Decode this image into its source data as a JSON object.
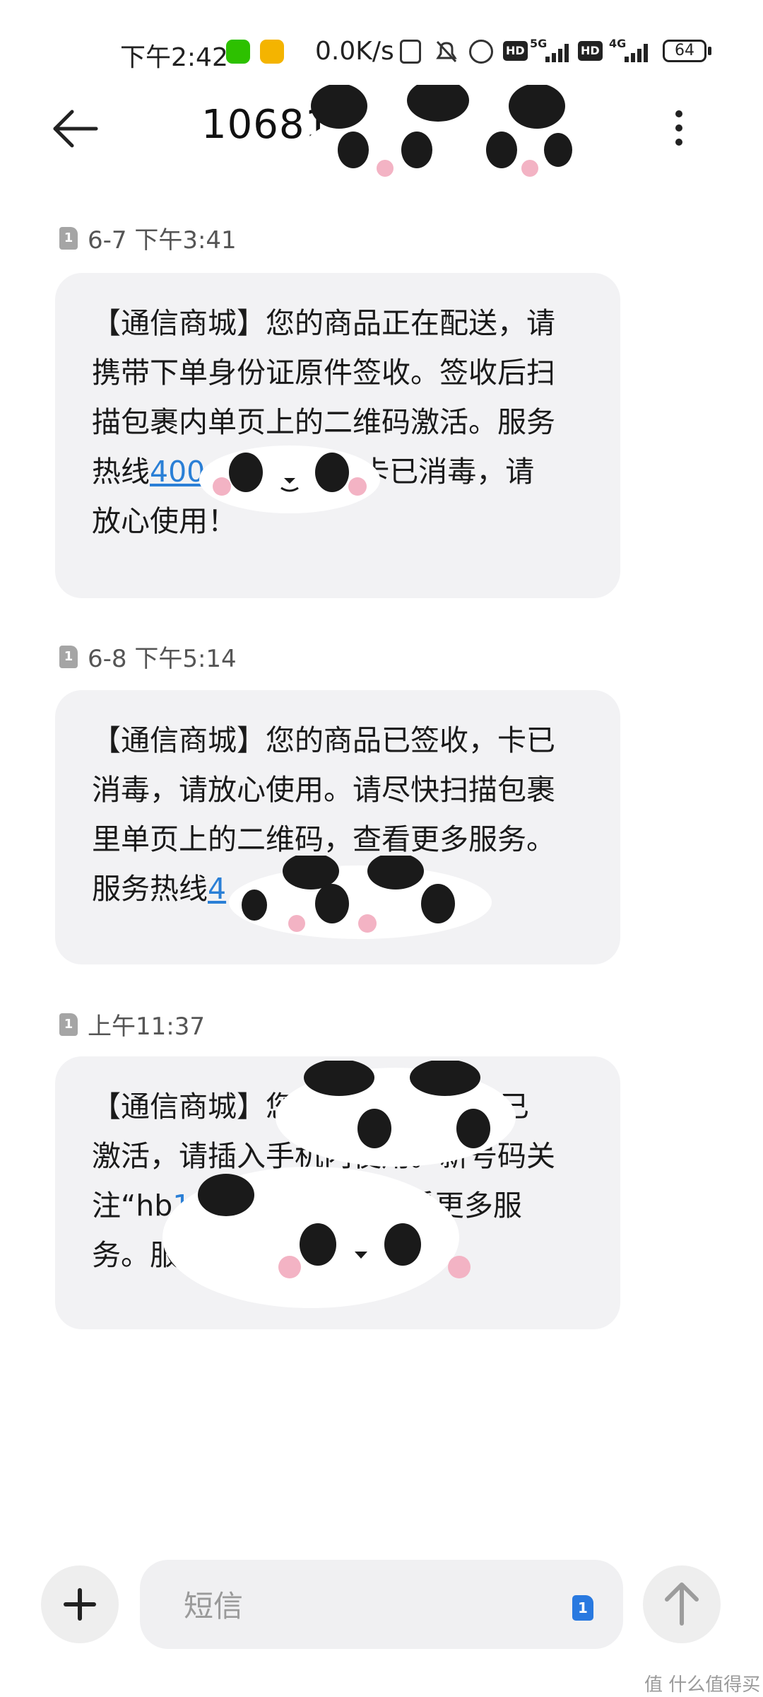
{
  "status_bar": {
    "time": "下午2:42",
    "net_speed": "0.0K/s",
    "sim1_network": "5G",
    "sim2_network": "4G",
    "hd_label": "HD",
    "battery": "64",
    "app_icons": [
      "wechat-icon",
      "weibo-icon"
    ]
  },
  "header": {
    "title": "10681",
    "back_icon": "arrow-left-icon",
    "menu_icon": "more-vertical-icon"
  },
  "messages": [
    {
      "sim": "1",
      "timestamp": "6-7 下午3:41",
      "lines": [
        {
          "text": "【通信商城】您的商品正在配送，请"
        },
        {
          "text": "携带下单身份证原件签收。签收后扫"
        },
        {
          "text": "描包裹内单页上的二维码激活。服务"
        },
        {
          "pre": "热线",
          "link": "400",
          "post": "卡已消毒，请"
        },
        {
          "text": "放心使用！"
        }
      ]
    },
    {
      "sim": "1",
      "timestamp": "6-8 下午5:14",
      "lines": [
        {
          "text": "【通信商城】您的商品已签收，卡已"
        },
        {
          "text": "消毒，请放心使用。请尽快扫描包裹"
        },
        {
          "text": "里单页上的二维码，查看更多服务。"
        },
        {
          "pre": "服务热线",
          "link": "4",
          "post": ""
        }
      ]
    },
    {
      "sim": "1",
      "timestamp": "上午11:37",
      "lines": [
        {
          "pre": "【通信商城】您的",
          "link": "",
          "post": "已"
        },
        {
          "text": "激活，请插入手机内使用。新号码关"
        },
        {
          "pre": "注“hb",
          "link": "1889",
          "post": "”公众号，享受更多服"
        },
        {
          "pre": "务。服务热线",
          "link": "4",
          "post": ""
        }
      ]
    }
  ],
  "composer": {
    "placeholder": "短信",
    "sim_badge": "1",
    "add_icon": "plus-icon",
    "send_icon": "arrow-up-icon"
  },
  "watermark": "值 什么值得买"
}
